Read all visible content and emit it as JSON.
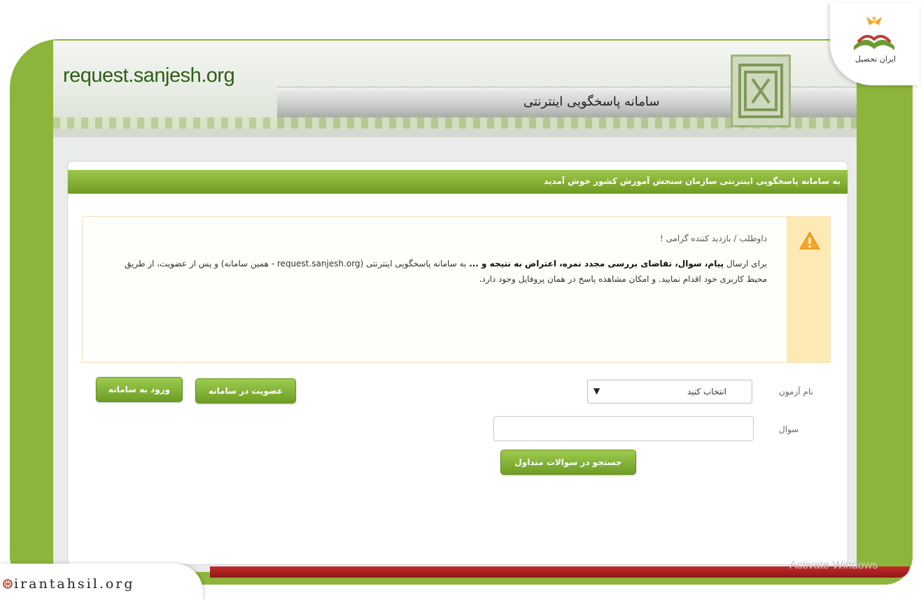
{
  "header": {
    "site_url": "request.sanjesh.org",
    "system_title": "سامانه پاسخگویی اینترنتی"
  },
  "welcome": {
    "text": "به سامانه پاسخگویی اینترنتی سازمان سنجش آموزش کشور خوش آمدید"
  },
  "notice": {
    "greeting": "داوطلب / بازدید کننده گرامی !",
    "line_prefix": "برای ارسال",
    "bold_items": "پیام، سوال، تقاضای بررسی مجدد نمره، اعتراض به نتیجه و ...",
    "line_rest": "به سامانه پاسخگویی اینترنتی (request.sanjesh.org - همین سامانه) و پس از عضویت، از طریق محیط کاربری خود اقدام نمایید. و امکان مشاهده پاسخ در همان پروفایل وجود دارد."
  },
  "form": {
    "exam_label": "نام آزمون",
    "exam_selected": "انتخاب کنید",
    "question_label": "سوال",
    "question_value": "",
    "search_button": "جستجو در سوالات متداول",
    "register_button": "عضویت در سامانه",
    "login_button": "ورود به سامانه"
  },
  "watermarks": {
    "brand_logo_text": "ایران تحصیل",
    "site_badge": "irantahsil.org",
    "os_text": "Activate Windows"
  },
  "colors": {
    "frame_green": "#8db53c",
    "button_green": "#7fae33",
    "title_green": "#2f5e17",
    "accent_red": "#b22222",
    "warning_bg": "#fde9b4"
  }
}
